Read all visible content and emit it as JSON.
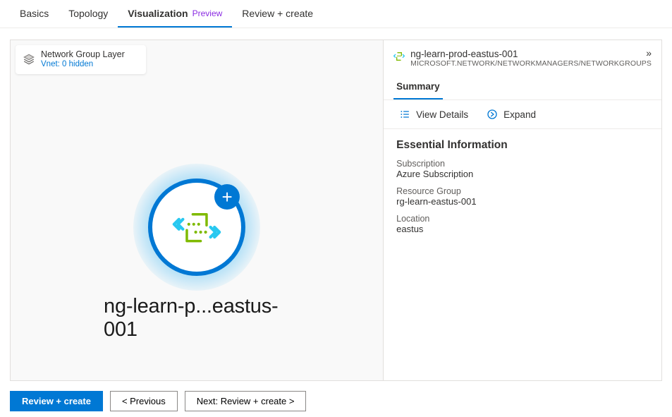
{
  "tabs": {
    "basics": "Basics",
    "topology": "Topology",
    "visualization": "Visualization",
    "preview_badge": "Preview",
    "review": "Review + create"
  },
  "layer_chip": {
    "title": "Network Group Layer",
    "subtitle": "Vnet: 0 hidden"
  },
  "node": {
    "label": "ng-learn-p...eastus-001",
    "plus": "+"
  },
  "details": {
    "title": "ng-learn-prod-eastus-001",
    "type": "MICROSOFT.NETWORK/NETWORKMANAGERS/NETWORKGROUPS",
    "chevrons": "»",
    "summary_label": "Summary",
    "actions": {
      "view_details": "View Details",
      "expand": "Expand"
    },
    "essential_heading": "Essential Information",
    "subscription": {
      "label": "Subscription",
      "value": "Azure Subscription"
    },
    "resource_group": {
      "label": "Resource Group",
      "value": "rg-learn-eastus-001"
    },
    "location": {
      "label": "Location",
      "value": "eastus"
    }
  },
  "footer": {
    "review_create": "Review + create",
    "previous": "< Previous",
    "next": "Next: Review + create >"
  }
}
